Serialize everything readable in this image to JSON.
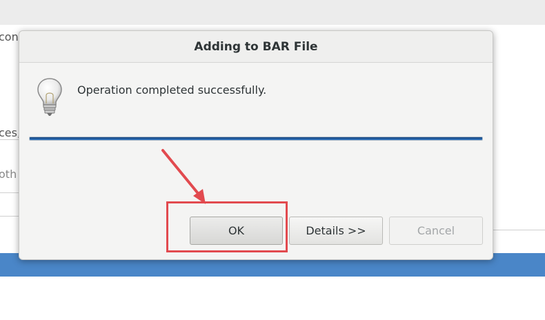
{
  "dialog": {
    "title": "Adding to BAR File",
    "message": "Operation completed successfully.",
    "progress_fraction": 1.0,
    "buttons": {
      "ok": "OK",
      "details": "Details >>",
      "cancel": "Cancel"
    },
    "cancel_enabled": false,
    "icon": "lightbulb-icon"
  },
  "background": {
    "fragment_1": "con",
    "fragment_2": "ces,",
    "fragment_3": "oth"
  },
  "annotation": {
    "color": "#e24a4f",
    "target": "ok-button"
  },
  "colors": {
    "progress": "#2b6cb4",
    "background_bar": "#4a86c8"
  }
}
